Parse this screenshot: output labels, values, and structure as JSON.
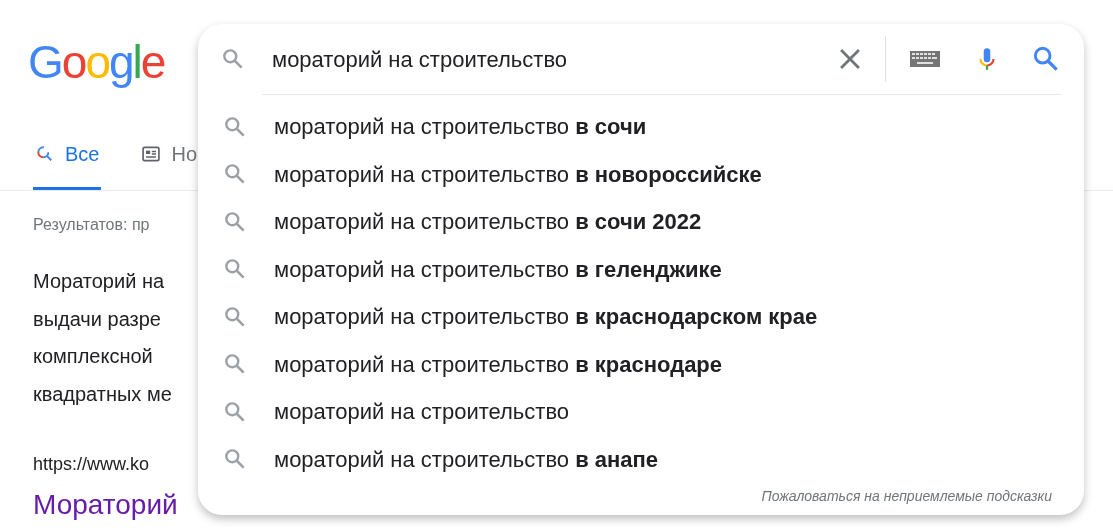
{
  "logo": "Google",
  "tabs": [
    {
      "label": "Все",
      "kind": "all",
      "selected": true
    },
    {
      "label": "Но",
      "kind": "news",
      "selected": false
    }
  ],
  "results_count": "Результатов: пр",
  "snippet_lines": [
    "Мораторий на",
    "выдачи разре",
    "комплексной",
    "квадратных ме"
  ],
  "result_url": "https://www.ko",
  "result_title": "Мораторий",
  "search": {
    "value": "мораторий на строительство"
  },
  "suggestions": [
    {
      "text": "мораторий на строительство **в сочи**"
    },
    {
      "text": "мораторий на строительство **в новороссийске**"
    },
    {
      "text": "мораторий на строительство **в сочи 2022**"
    },
    {
      "text": "мораторий на строительство **в геленджике**"
    },
    {
      "text": "мораторий на строительство **в краснодарском крае**"
    },
    {
      "text": "мораторий на строительство **в краснодаре**"
    },
    {
      "text": "мораторий на строительство"
    },
    {
      "text": "мораторий на строительство **в анапе**"
    }
  ],
  "report_link": "Пожаловаться на неприемлемые подсказки"
}
